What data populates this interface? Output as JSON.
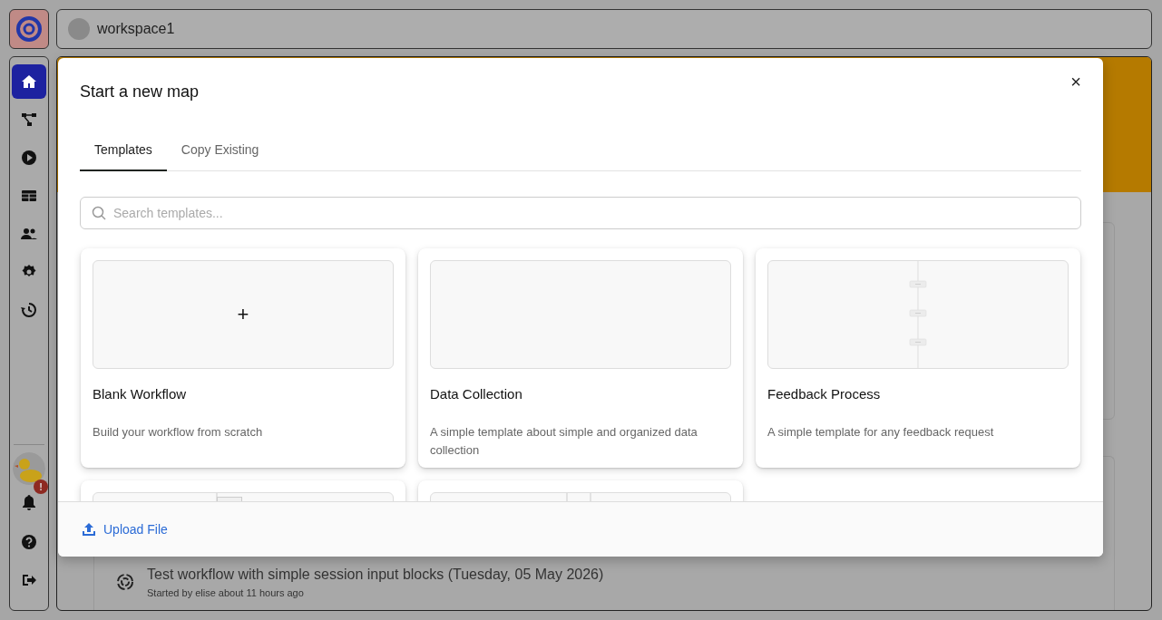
{
  "sidebar": {
    "items": [
      {
        "kind": "home",
        "selected": true
      },
      {
        "kind": "hierarchy",
        "selected": false
      },
      {
        "kind": "play",
        "selected": false
      },
      {
        "kind": "table",
        "selected": false
      },
      {
        "kind": "users",
        "selected": false
      },
      {
        "kind": "gear",
        "selected": false
      },
      {
        "kind": "history",
        "selected": false
      }
    ],
    "notification_badge": "!",
    "bottom_items": [
      {
        "kind": "help"
      },
      {
        "kind": "logout"
      }
    ]
  },
  "workspace": {
    "name": "workspace1"
  },
  "background_list": {
    "items": [
      {
        "title": "Test workflow with simple session input blocks (Tuesday, 05 May 2026)",
        "subtitle": "Started by elise about 11 hours ago"
      }
    ]
  },
  "modal": {
    "title": "Start a new map",
    "close": "×",
    "tabs": [
      {
        "label": "Templates",
        "selected": true
      },
      {
        "label": "Copy Existing",
        "selected": false
      }
    ],
    "search": {
      "placeholder": "Search templates..."
    },
    "templates": [
      {
        "preview": {
          "kind": "add",
          "symbol": "+"
        },
        "title": "Blank Workflow",
        "description": "Build your workflow from scratch"
      },
      {
        "preview": {
          "kind": "empty"
        },
        "title": "Data Collection",
        "description": "A simple template about simple and organized data collection"
      },
      {
        "preview": {
          "kind": "flow"
        },
        "title": "Feedback Process",
        "description": "A simple template for any feedback request"
      },
      {
        "preview": {
          "kind": "branch"
        }
      },
      {
        "preview": {
          "kind": "split"
        }
      }
    ],
    "footer": {
      "upload_link": "Upload File"
    }
  }
}
